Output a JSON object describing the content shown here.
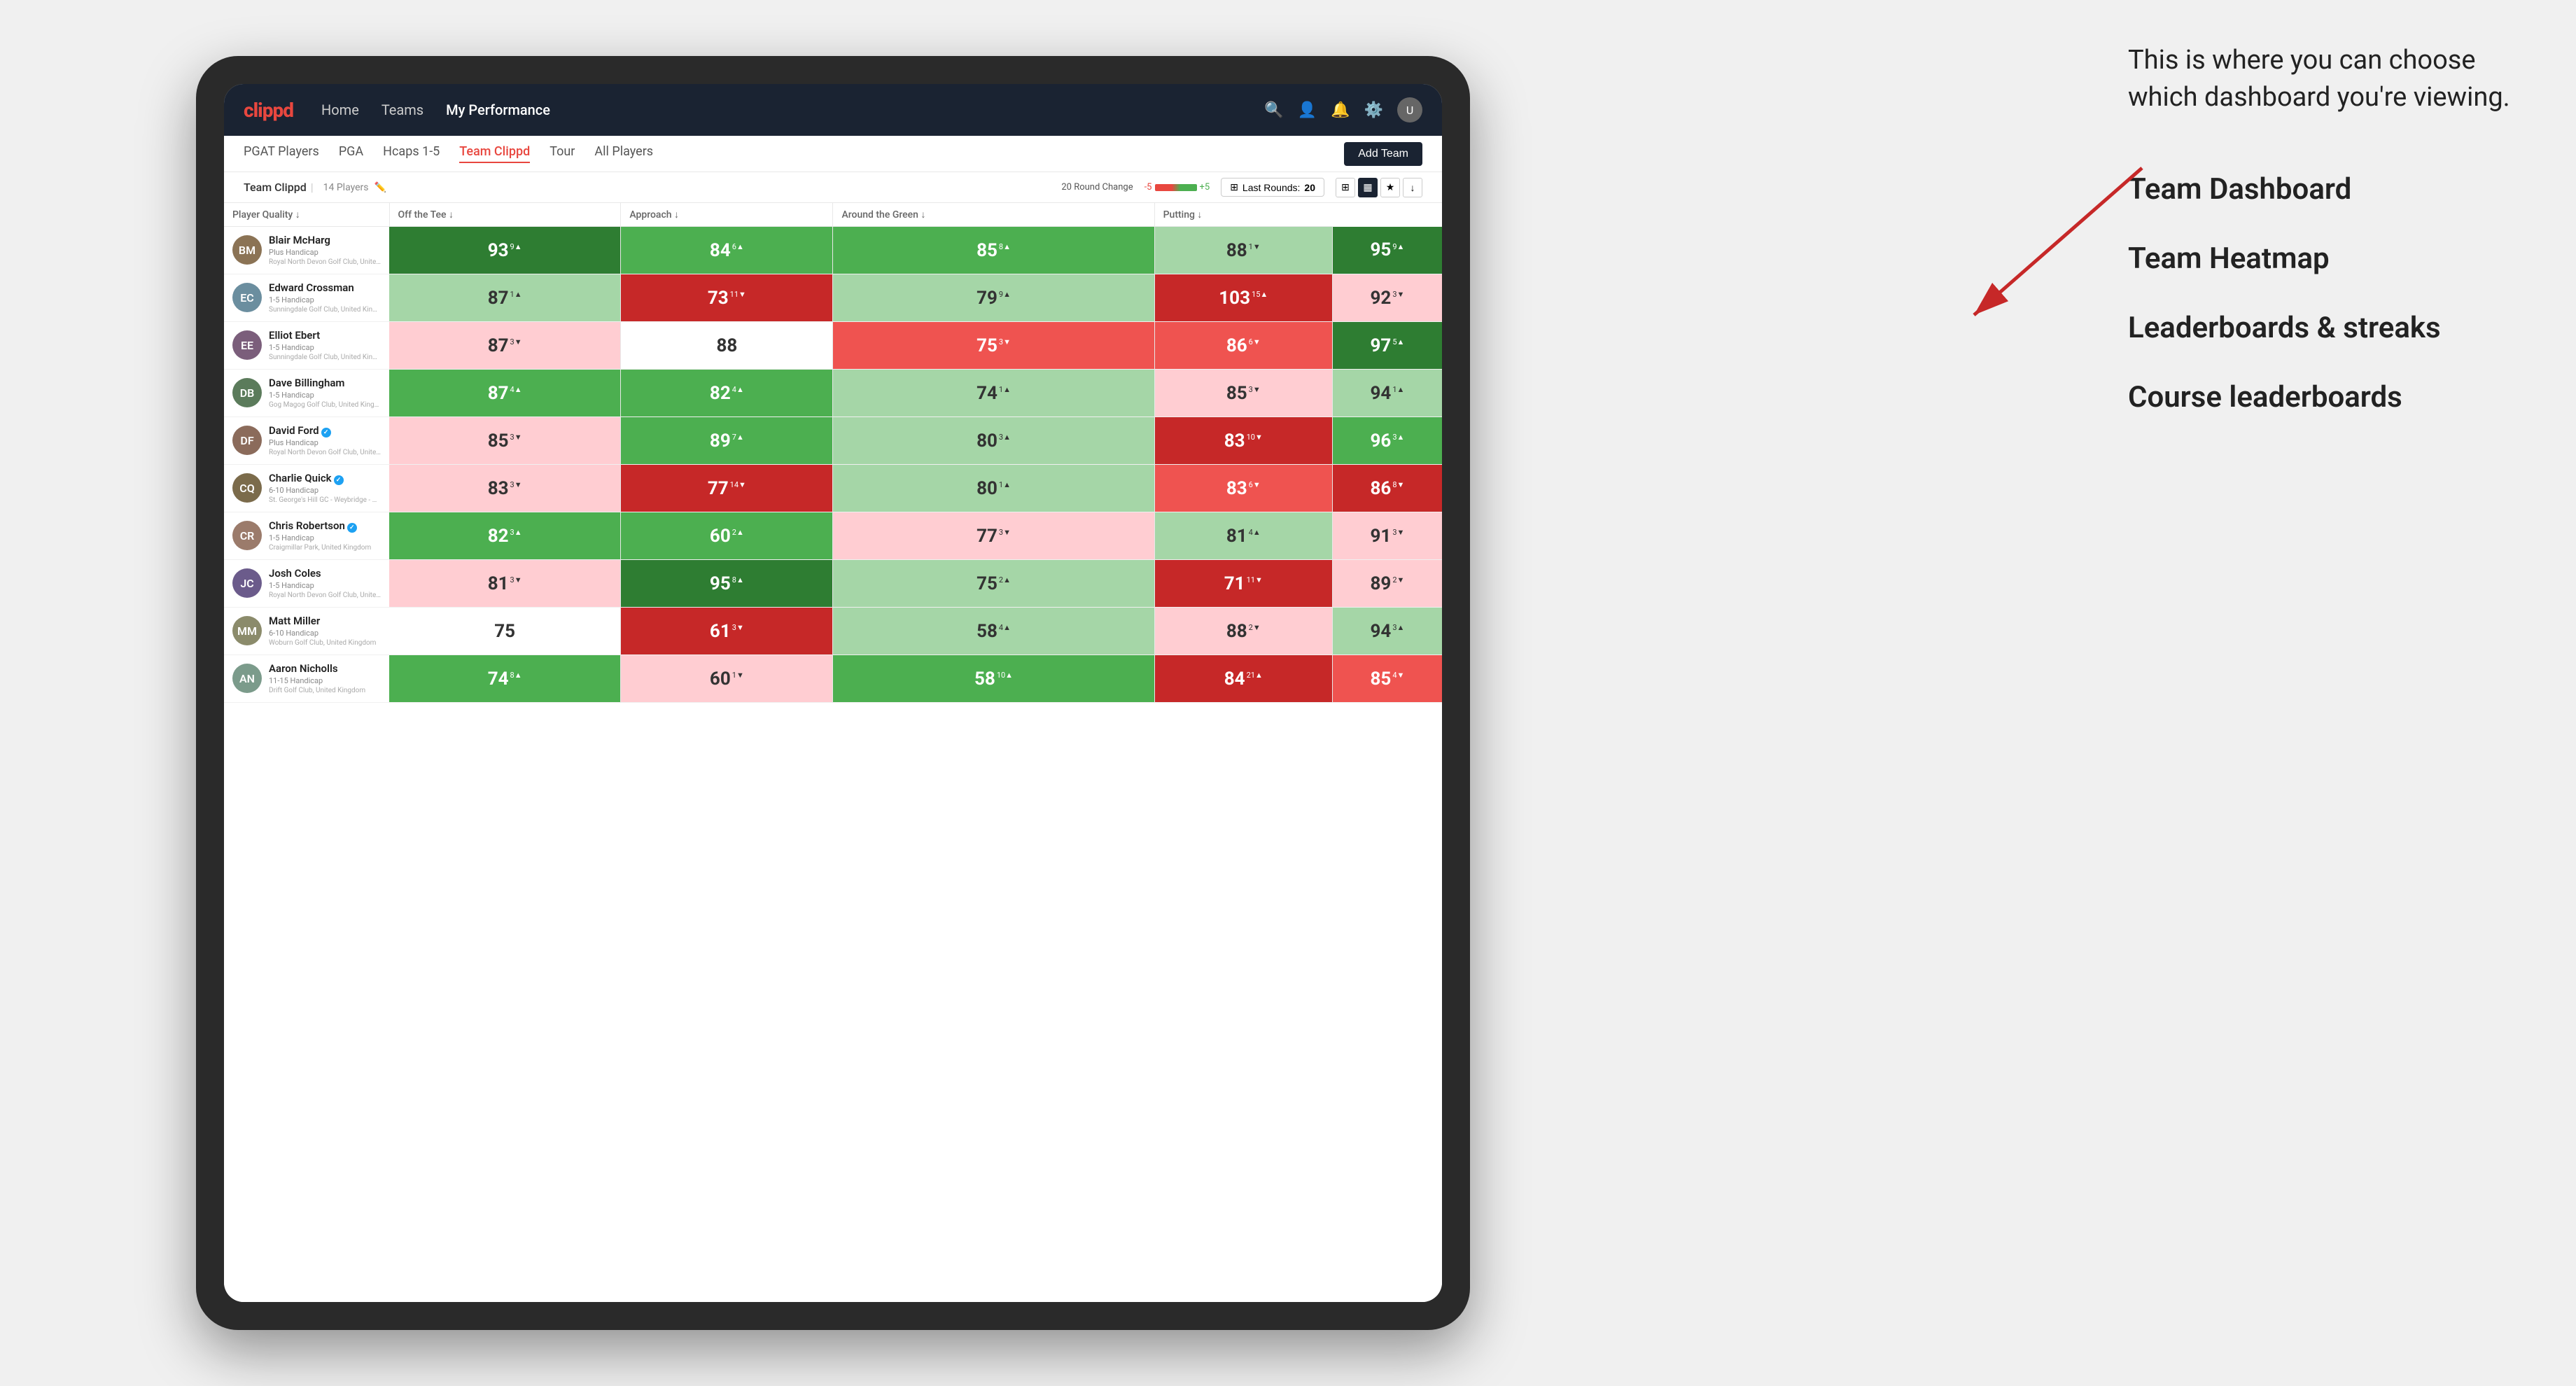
{
  "annotation": {
    "callout": "This is where you can choose which dashboard you're viewing.",
    "options": [
      "Team Dashboard",
      "Team Heatmap",
      "Leaderboards & streaks",
      "Course leaderboards"
    ]
  },
  "navbar": {
    "logo": "clippd",
    "links": [
      "Home",
      "Teams",
      "My Performance"
    ],
    "active_link": "My Performance"
  },
  "subtabs": {
    "tabs": [
      "PGAT Players",
      "PGA",
      "Hcaps 1-5",
      "Team Clippd",
      "Tour",
      "All Players"
    ],
    "active_tab": "Team Clippd",
    "add_team_label": "Add Team"
  },
  "team_bar": {
    "name": "Team Clippd",
    "separator": "|",
    "count": "14 Players",
    "round_change_label": "20 Round Change",
    "change_neg": "-5",
    "change_pos": "+5",
    "last_rounds_label": "Last Rounds:",
    "last_rounds_value": "20"
  },
  "table": {
    "columns": [
      {
        "label": "Player Quality",
        "arrow": "↓"
      },
      {
        "label": "Off the Tee",
        "arrow": "↓"
      },
      {
        "label": "Approach",
        "arrow": "↓"
      },
      {
        "label": "Around the Green",
        "arrow": "↓"
      },
      {
        "label": "Putting",
        "arrow": "↓"
      }
    ],
    "rows": [
      {
        "name": "Blair McHarg",
        "handicap": "Plus Handicap",
        "club": "Royal North Devon Golf Club, United Kingdom",
        "avatar_color": "#8B7355",
        "avatar_initials": "BM",
        "scores": [
          {
            "val": "93",
            "change": "9",
            "dir": "up",
            "color": "green-dark"
          },
          {
            "val": "84",
            "change": "6",
            "dir": "up",
            "color": "green-mid"
          },
          {
            "val": "85",
            "change": "8",
            "dir": "up",
            "color": "green-mid"
          },
          {
            "val": "88",
            "change": "1",
            "dir": "down",
            "color": "green-light"
          },
          {
            "val": "95",
            "change": "9",
            "dir": "up",
            "color": "green-dark"
          }
        ]
      },
      {
        "name": "Edward Crossman",
        "handicap": "1-5 Handicap",
        "club": "Sunningdale Golf Club, United Kingdom",
        "avatar_color": "#6B8E9F",
        "avatar_initials": "EC",
        "scores": [
          {
            "val": "87",
            "change": "1",
            "dir": "up",
            "color": "green-light"
          },
          {
            "val": "73",
            "change": "11",
            "dir": "down",
            "color": "red-dark"
          },
          {
            "val": "79",
            "change": "9",
            "dir": "up",
            "color": "green-light"
          },
          {
            "val": "103",
            "change": "15",
            "dir": "up",
            "color": "red-dark"
          },
          {
            "val": "92",
            "change": "3",
            "dir": "down",
            "color": "red-light"
          }
        ]
      },
      {
        "name": "Elliot Ebert",
        "handicap": "1-5 Handicap",
        "club": "Sunningdale Golf Club, United Kingdom",
        "avatar_color": "#7B5E7B",
        "avatar_initials": "EE",
        "scores": [
          {
            "val": "87",
            "change": "3",
            "dir": "down",
            "color": "red-light"
          },
          {
            "val": "88",
            "change": "",
            "dir": "",
            "color": "neutral"
          },
          {
            "val": "75",
            "change": "3",
            "dir": "down",
            "color": "red-mid"
          },
          {
            "val": "86",
            "change": "6",
            "dir": "down",
            "color": "red-mid"
          },
          {
            "val": "97",
            "change": "5",
            "dir": "up",
            "color": "green-dark"
          }
        ]
      },
      {
        "name": "Dave Billingham",
        "handicap": "1-5 Handicap",
        "club": "Gog Magog Golf Club, United Kingdom",
        "avatar_color": "#5B7B5B",
        "avatar_initials": "DB",
        "scores": [
          {
            "val": "87",
            "change": "4",
            "dir": "up",
            "color": "green-mid"
          },
          {
            "val": "82",
            "change": "4",
            "dir": "up",
            "color": "green-mid"
          },
          {
            "val": "74",
            "change": "1",
            "dir": "up",
            "color": "green-light"
          },
          {
            "val": "85",
            "change": "3",
            "dir": "down",
            "color": "red-light"
          },
          {
            "val": "94",
            "change": "1",
            "dir": "up",
            "color": "green-light"
          }
        ]
      },
      {
        "name": "David Ford",
        "handicap": "Plus Handicap",
        "club": "Royal North Devon Golf Club, United Kingdom",
        "avatar_color": "#8B6B5B",
        "avatar_initials": "DF",
        "verified": true,
        "scores": [
          {
            "val": "85",
            "change": "3",
            "dir": "down",
            "color": "red-light"
          },
          {
            "val": "89",
            "change": "7",
            "dir": "up",
            "color": "green-mid"
          },
          {
            "val": "80",
            "change": "3",
            "dir": "up",
            "color": "green-light"
          },
          {
            "val": "83",
            "change": "10",
            "dir": "down",
            "color": "red-dark"
          },
          {
            "val": "96",
            "change": "3",
            "dir": "up",
            "color": "green-mid"
          }
        ]
      },
      {
        "name": "Charlie Quick",
        "handicap": "6-10 Handicap",
        "club": "St. George's Hill GC - Weybridge - Surrey, Uni...",
        "avatar_color": "#7B6B4B",
        "avatar_initials": "CQ",
        "verified": true,
        "scores": [
          {
            "val": "83",
            "change": "3",
            "dir": "down",
            "color": "red-light"
          },
          {
            "val": "77",
            "change": "14",
            "dir": "down",
            "color": "red-dark"
          },
          {
            "val": "80",
            "change": "1",
            "dir": "up",
            "color": "green-light"
          },
          {
            "val": "83",
            "change": "6",
            "dir": "down",
            "color": "red-mid"
          },
          {
            "val": "86",
            "change": "8",
            "dir": "down",
            "color": "red-dark"
          }
        ]
      },
      {
        "name": "Chris Robertson",
        "handicap": "1-5 Handicap",
        "club": "Craigmillar Park, United Kingdom",
        "avatar_color": "#9B7B6B",
        "avatar_initials": "CR",
        "verified": true,
        "scores": [
          {
            "val": "82",
            "change": "3",
            "dir": "up",
            "color": "green-mid"
          },
          {
            "val": "60",
            "change": "2",
            "dir": "up",
            "color": "green-mid"
          },
          {
            "val": "77",
            "change": "3",
            "dir": "down",
            "color": "red-light"
          },
          {
            "val": "81",
            "change": "4",
            "dir": "up",
            "color": "green-light"
          },
          {
            "val": "91",
            "change": "3",
            "dir": "down",
            "color": "red-light"
          }
        ]
      },
      {
        "name": "Josh Coles",
        "handicap": "1-5 Handicap",
        "club": "Royal North Devon Golf Club, United Kingdom",
        "avatar_color": "#6B5B8B",
        "avatar_initials": "JC",
        "scores": [
          {
            "val": "81",
            "change": "3",
            "dir": "down",
            "color": "red-light"
          },
          {
            "val": "95",
            "change": "8",
            "dir": "up",
            "color": "green-dark"
          },
          {
            "val": "75",
            "change": "2",
            "dir": "up",
            "color": "green-light"
          },
          {
            "val": "71",
            "change": "11",
            "dir": "down",
            "color": "red-dark"
          },
          {
            "val": "89",
            "change": "2",
            "dir": "down",
            "color": "red-light"
          }
        ]
      },
      {
        "name": "Matt Miller",
        "handicap": "6-10 Handicap",
        "club": "Woburn Golf Club, United Kingdom",
        "avatar_color": "#8B8B6B",
        "avatar_initials": "MM",
        "scores": [
          {
            "val": "75",
            "change": "",
            "dir": "",
            "color": "neutral"
          },
          {
            "val": "61",
            "change": "3",
            "dir": "down",
            "color": "red-dark"
          },
          {
            "val": "58",
            "change": "4",
            "dir": "up",
            "color": "green-light"
          },
          {
            "val": "88",
            "change": "2",
            "dir": "down",
            "color": "red-light"
          },
          {
            "val": "94",
            "change": "3",
            "dir": "up",
            "color": "green-light"
          }
        ]
      },
      {
        "name": "Aaron Nicholls",
        "handicap": "11-15 Handicap",
        "club": "Drift Golf Club, United Kingdom",
        "avatar_color": "#7B9B8B",
        "avatar_initials": "AN",
        "scores": [
          {
            "val": "74",
            "change": "8",
            "dir": "up",
            "color": "green-mid"
          },
          {
            "val": "60",
            "change": "1",
            "dir": "down",
            "color": "red-light"
          },
          {
            "val": "58",
            "change": "10",
            "dir": "up",
            "color": "green-mid"
          },
          {
            "val": "84",
            "change": "21",
            "dir": "up",
            "color": "red-dark"
          },
          {
            "val": "85",
            "change": "4",
            "dir": "down",
            "color": "red-mid"
          }
        ]
      }
    ]
  }
}
